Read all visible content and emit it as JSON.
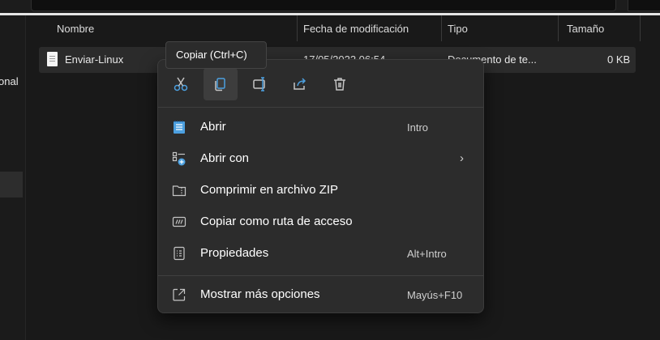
{
  "nav": {
    "fragment": "onal"
  },
  "columns": {
    "name": "Nombre",
    "date": "Fecha de modificación",
    "type": "Tipo",
    "size": "Tamaño"
  },
  "file": {
    "name": "Enviar-Linux",
    "date": "17/05/2022 06:54",
    "type": "Documento de te...",
    "size": "0 KB"
  },
  "tooltip": "Copiar (Ctrl+C)",
  "quick_actions": [
    {
      "icon": "cut-icon"
    },
    {
      "icon": "copy-icon"
    },
    {
      "icon": "rename-icon"
    },
    {
      "icon": "share-icon"
    },
    {
      "icon": "delete-icon"
    }
  ],
  "menu": {
    "open": {
      "label": "Abrir",
      "shortcut": "Intro"
    },
    "open_with": {
      "label": "Abrir con"
    },
    "zip": {
      "label": "Comprimir en archivo ZIP"
    },
    "copy_path": {
      "label": "Copiar como ruta de acceso"
    },
    "properties": {
      "label": "Propiedades",
      "shortcut": "Alt+Intro"
    },
    "more": {
      "label": "Mostrar más opciones",
      "shortcut": "Mayús+F10"
    }
  },
  "colors": {
    "accent": "#4ca0e0",
    "icon": "#c5c5c5",
    "menu_bg": "#2c2c2c",
    "window_bg": "#191919"
  }
}
